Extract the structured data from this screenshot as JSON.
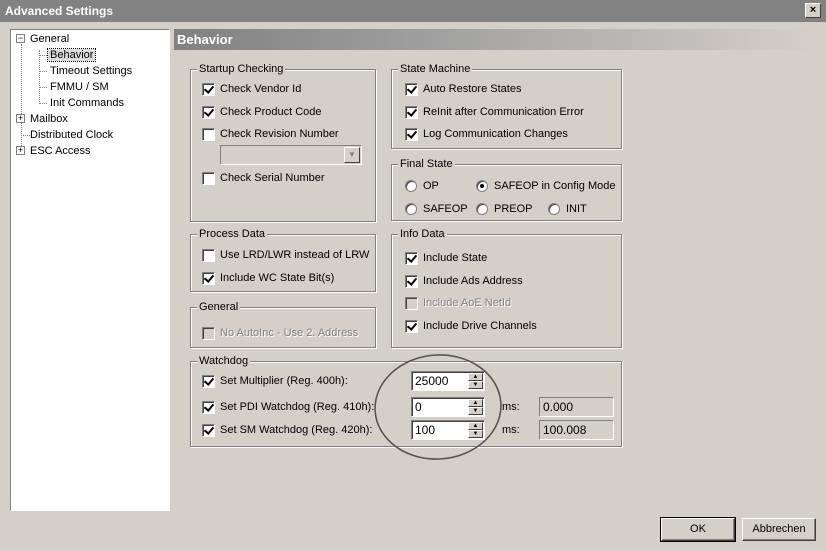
{
  "window": {
    "title": "Advanced Settings",
    "close_glyph": "×"
  },
  "tree": {
    "general": "General",
    "behavior": "Behavior",
    "timeout_settings": "Timeout Settings",
    "fmmu_sm": "FMMU / SM",
    "init_commands": "Init Commands",
    "mailbox": "Mailbox",
    "distributed_clock": "Distributed Clock",
    "esc_access": "ESC Access",
    "expanded_glyph": "−",
    "collapsed_glyph": "+"
  },
  "panel": {
    "title": "Behavior"
  },
  "startup_checking": {
    "legend": "Startup Checking",
    "check_vendor_id": {
      "label": "Check Vendor Id",
      "checked": true
    },
    "check_product_code": {
      "label": "Check Product Code",
      "checked": true
    },
    "check_revision_number": {
      "label": "Check Revision Number",
      "checked": false
    },
    "revision_combo_value": "",
    "check_serial_number": {
      "label": "Check Serial Number",
      "checked": false
    }
  },
  "state_machine": {
    "legend": "State Machine",
    "auto_restore_states": {
      "label": "Auto Restore States",
      "checked": true
    },
    "reinit_after_error": {
      "label": "ReInit after Communication Error",
      "checked": true
    },
    "log_comm_changes": {
      "label": "Log Communication Changes",
      "checked": true
    }
  },
  "final_state": {
    "legend": "Final State",
    "op": "OP",
    "safeop_config": "SAFEOP in Config Mode",
    "safeop": "SAFEOP",
    "preop": "PREOP",
    "init": "INIT",
    "selected": "safeop_config"
  },
  "process_data": {
    "legend": "Process Data",
    "use_lrd_lwr": {
      "label": "Use LRD/LWR instead of LRW",
      "checked": false
    },
    "include_wc_state": {
      "label": "Include WC State Bit(s)",
      "checked": true
    }
  },
  "info_data": {
    "legend": "Info Data",
    "include_state": {
      "label": "Include State",
      "checked": true
    },
    "include_ads_address": {
      "label": "Include Ads Address",
      "checked": true
    },
    "include_aoe_netid": {
      "label": "Include AoE NetId",
      "checked": false,
      "disabled": true
    },
    "include_drive_channels": {
      "label": "Include Drive Channels",
      "checked": true
    }
  },
  "general_group": {
    "legend": "General",
    "no_autoinc": {
      "label": "No AutoInc - Use 2. Address",
      "checked": false,
      "disabled": true
    }
  },
  "watchdog": {
    "legend": "Watchdog",
    "set_multiplier": {
      "label": "Set Multiplier (Reg. 400h):",
      "checked": true,
      "value": "25000"
    },
    "set_pdi": {
      "label": "Set PDI Watchdog (Reg. 410h):",
      "checked": true,
      "value": "0",
      "unit": "ms:",
      "readout": "0.000"
    },
    "set_sm": {
      "label": "Set SM Watchdog (Reg. 420h):",
      "checked": true,
      "value": "100",
      "unit": "ms:",
      "readout": "100.008"
    }
  },
  "buttons": {
    "ok": "OK",
    "cancel": "Abbrechen"
  },
  "icons": {
    "spin_up": "▲",
    "spin_down": "▼",
    "combo_arrow": "▼"
  }
}
